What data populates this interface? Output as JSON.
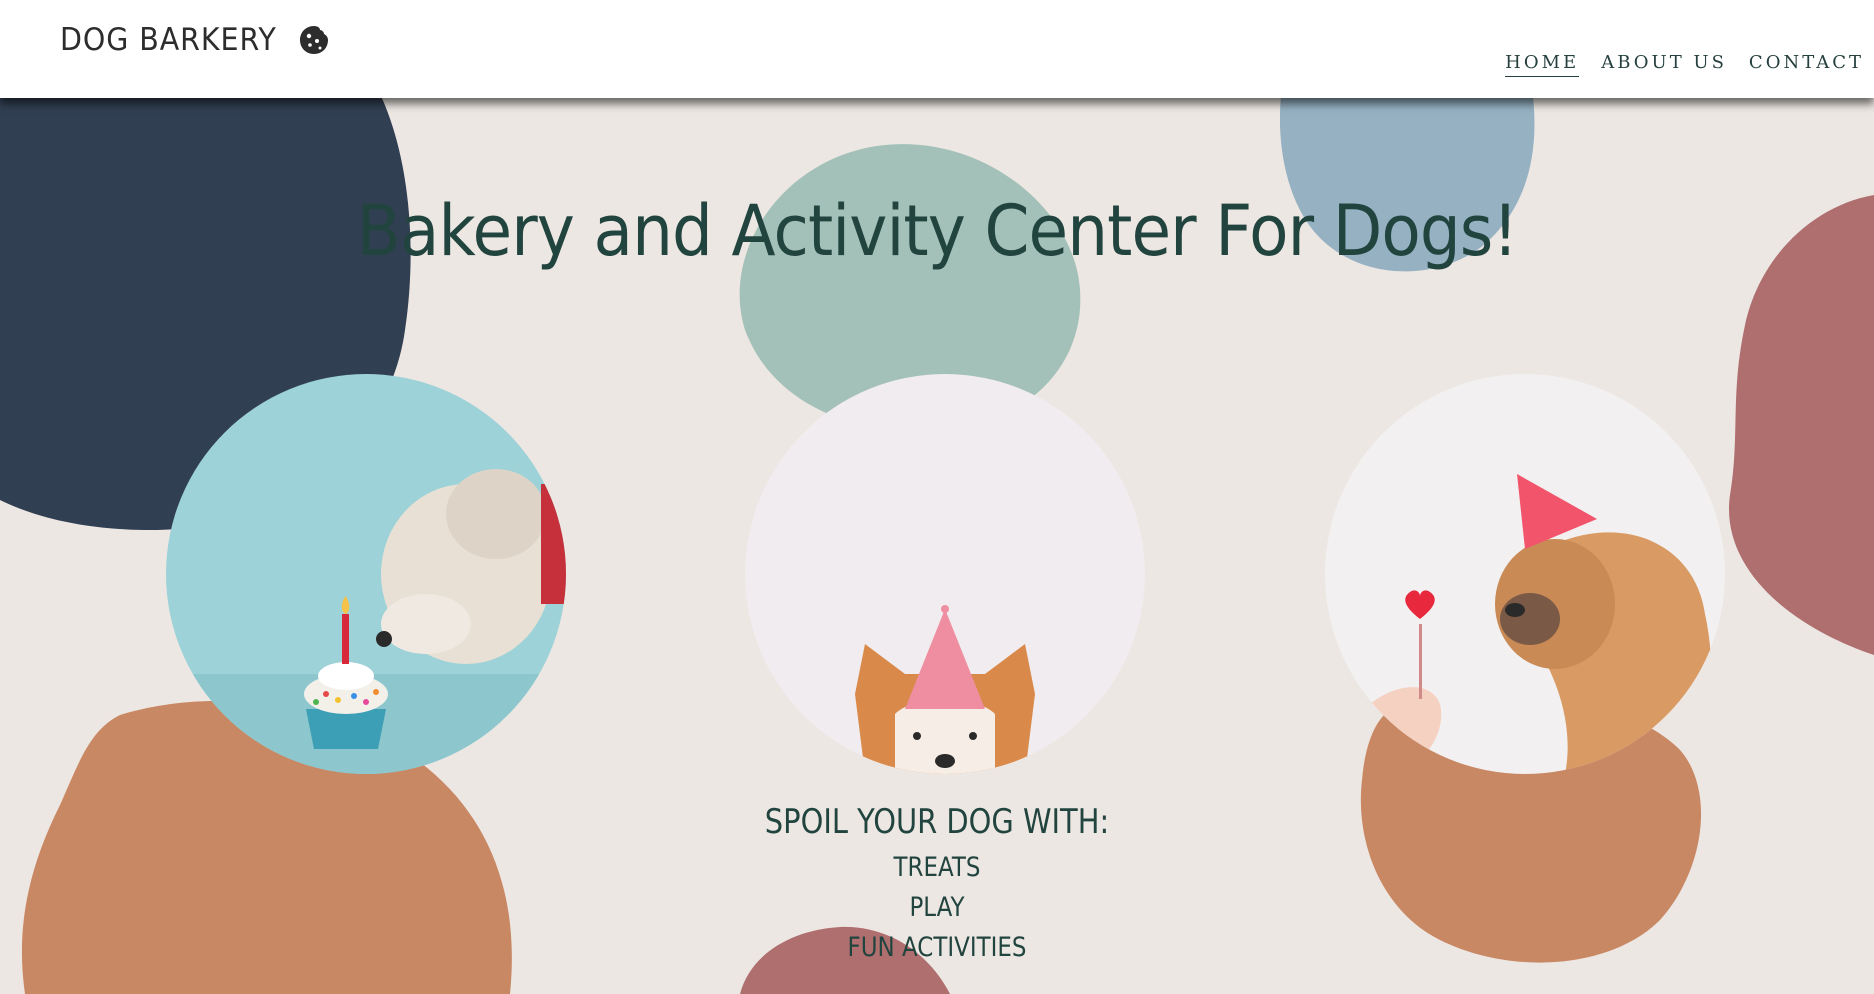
{
  "brand": {
    "name": "DOG BARKERY",
    "icon": "cookie-icon"
  },
  "nav": {
    "items": [
      {
        "label": "HOME",
        "active": true
      },
      {
        "label": "ABOUT US",
        "active": false
      },
      {
        "label": "CONTACT",
        "active": false
      }
    ]
  },
  "hero": {
    "title": "Bakery and Activity Center For Dogs!"
  },
  "photos": [
    {
      "subject": "fluffy-dog-with-cupcake"
    },
    {
      "subject": "shiba-dog-with-party-hat"
    },
    {
      "subject": "sharpei-dog-with-party-hat"
    }
  ],
  "spoil": {
    "heading": "SPOIL YOUR DOG WITH:",
    "items": [
      "TREATS",
      "PLAY",
      "FUN ACTIVITIES"
    ]
  },
  "colors": {
    "background": "#ede7e3",
    "navy": "#313f52",
    "sage": "#a3c1b8",
    "dusty_blue": "#95b1c2",
    "rose": "#b06f6f",
    "terracotta": "#c98864",
    "text_dark": "#22443f"
  }
}
